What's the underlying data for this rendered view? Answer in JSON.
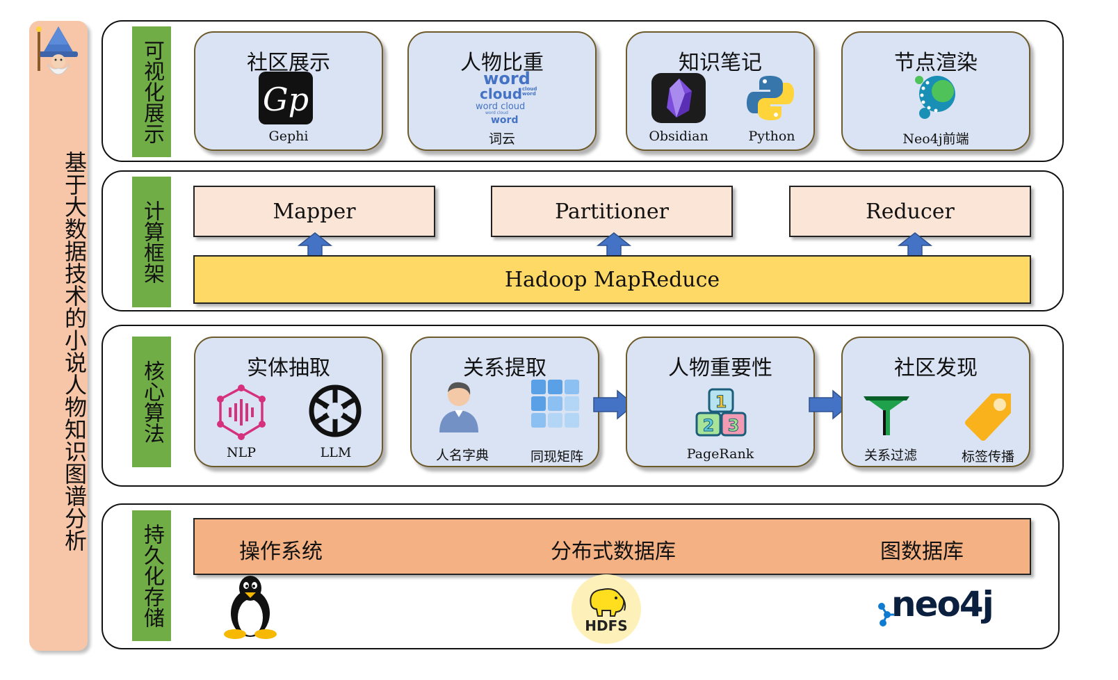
{
  "side": {
    "title": "基于大数据技术的小说人物知识图谱分析"
  },
  "layers": {
    "visual": {
      "label": "可视化展示",
      "cards": [
        {
          "title": "社区展示",
          "captions": [
            "Gephi"
          ]
        },
        {
          "title": "人物比重",
          "captions": [
            "词云"
          ],
          "wordcloud": [
            "word",
            "cloud",
            "cloud",
            "word",
            "word cloud",
            "word cloud",
            "word"
          ]
        },
        {
          "title": "知识笔记",
          "captions": [
            "Obsidian",
            "Python"
          ]
        },
        {
          "title": "节点渲染",
          "captions": [
            "Neo4j前端"
          ]
        }
      ]
    },
    "compute": {
      "label": "计算框架",
      "stages": [
        "Mapper",
        "Partitioner",
        "Reducer"
      ],
      "base": "Hadoop MapReduce"
    },
    "algo": {
      "label": "核心算法",
      "cards": [
        {
          "title": "实体抽取",
          "captions": [
            "NLP",
            "LLM"
          ]
        },
        {
          "title": "关系提取",
          "captions": [
            "人名字典",
            "同现矩阵"
          ]
        },
        {
          "title": "人物重要性",
          "captions": [
            "PageRank"
          ],
          "blocks": [
            "1",
            "2",
            "3"
          ]
        },
        {
          "title": "社区发现",
          "captions": [
            "关系过滤",
            "标签传播"
          ]
        }
      ]
    },
    "storage": {
      "label": "持久化存储",
      "items": [
        "操作系统",
        "分布式数据库",
        "图数据库"
      ],
      "logos": {
        "hdfs": "HDFS",
        "neo4j": "neo4j"
      }
    }
  },
  "colors": {
    "label_green": "#70ad47",
    "card_blue": "#dae3f3",
    "peach": "#fbe5d6",
    "yellow": "#ffd966",
    "orange": "#f4b183",
    "arrow_blue": "#4472c4",
    "side_bg": "#f7c6a8"
  }
}
